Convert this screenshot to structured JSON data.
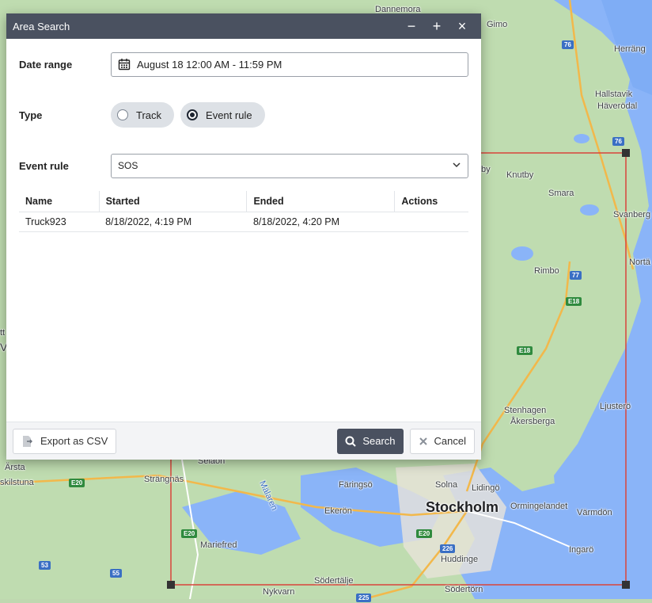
{
  "dialog": {
    "title": "Area Search",
    "controls": {
      "minimize": "−",
      "maximize": "+",
      "close": "×"
    },
    "date_range": {
      "label": "Date range",
      "value": "August 18 12:00 AM - 11:59 PM",
      "icon": "calendar-icon"
    },
    "type": {
      "label": "Type",
      "options": [
        {
          "label": "Track",
          "checked": false
        },
        {
          "label": "Event rule",
          "checked": true
        }
      ]
    },
    "event_rule": {
      "label": "Event rule",
      "value": "SOS",
      "icon": "chevron-down-icon"
    },
    "table": {
      "columns": [
        "Name",
        "Started",
        "Ended",
        "Actions"
      ],
      "rows": [
        {
          "name": "Truck923",
          "started": "8/18/2022, 4:19 PM",
          "ended": "8/18/2022, 4:20 PM",
          "actions": ""
        }
      ]
    },
    "footer": {
      "export_label": "Export as CSV",
      "search_label": "Search",
      "cancel_label": "Cancel"
    }
  },
  "map": {
    "labels": {
      "dannemora": "Dannemora",
      "gimo": "Gimo",
      "herrang": "Herräng",
      "hallstavik": "Hallstavik",
      "haverodal": "Häverödal",
      "knutby": "Knutby",
      "by": "by",
      "smara": "Smara",
      "svanberga": "Svanberg",
      "rimbo": "Rimbo",
      "nortalje": "Nortä",
      "stenhagen": "Stenhagen",
      "akersberga": "Åkersberga",
      "ljustero": "Ljusterö",
      "arsta": "Ärsta",
      "eskilstuna": "skilstuna",
      "strangnas": "Strängnäs",
      "selaon": "Selaön",
      "faringso": "Färingsö",
      "solna": "Solna",
      "lidingo": "Lidingö",
      "ekeron": "Ekerön",
      "mariefred": "Mariefred",
      "malaren": "Mälaren",
      "orminge": "Ormingelandet",
      "vardon": "Värmdön",
      "huddinge": "Huddinge",
      "ingaro": "Ingarö",
      "sodertalje": "Södertälje",
      "nykvarn": "Nykvarn",
      "sodertorn": "Södertörn",
      "v": "V",
      "tt": "tt"
    },
    "stockholm": "Stockholm",
    "shields": {
      "r76a": "76",
      "r76b": "76",
      "r77": "77",
      "e18a": "E18",
      "e18b": "E18",
      "e20a": "E20",
      "e20b": "E20",
      "e20c": "E20",
      "r226": "226",
      "r225": "225",
      "r53": "53",
      "r55": "55"
    },
    "selection_color": "#d9443a"
  }
}
